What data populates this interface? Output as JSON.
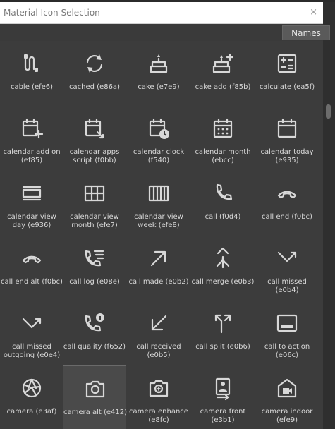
{
  "window": {
    "title": "Material Icon Selection",
    "close": "×"
  },
  "toolbar": {
    "names_label": "Names"
  },
  "icons": [
    [
      "cable (efe6)",
      "cable-icon"
    ],
    [
      "cached (e86a)",
      "cached-icon"
    ],
    [
      "cake (e7e9)",
      "cake-icon"
    ],
    [
      "cake add (f85b)",
      "cake-add-icon"
    ],
    [
      "calculate (ea5f)",
      "calculate-icon"
    ],
    [
      "calendar add on (ef85)",
      "calendar-add-on-icon"
    ],
    [
      "calendar apps script (f0bb)",
      "calendar-apps-script-icon"
    ],
    [
      "calendar clock (f540)",
      "calendar-clock-icon"
    ],
    [
      "calendar month (ebcc)",
      "calendar-month-icon"
    ],
    [
      "calendar today (e935)",
      "calendar-today-icon"
    ],
    [
      "calendar view day (e936)",
      "calendar-view-day-icon"
    ],
    [
      "calendar view month (efe7)",
      "calendar-view-month-icon"
    ],
    [
      "calendar view week (efe8)",
      "calendar-view-week-icon"
    ],
    [
      "call (f0d4)",
      "call-icon"
    ],
    [
      "call end (f0bc)",
      "call-end-icon"
    ],
    [
      "call end alt (f0bc)",
      "call-end-alt-icon"
    ],
    [
      "call log (e08e)",
      "call-log-icon"
    ],
    [
      "call made (e0b2)",
      "call-made-icon"
    ],
    [
      "call merge (e0b3)",
      "call-merge-icon"
    ],
    [
      "call missed (e0b4)",
      "call-missed-icon"
    ],
    [
      "call missed outgoing (e0e4)",
      "call-missed-outgoing-icon"
    ],
    [
      "call quality (f652)",
      "call-quality-icon"
    ],
    [
      "call received (e0b5)",
      "call-received-icon"
    ],
    [
      "call split (e0b6)",
      "call-split-icon"
    ],
    [
      "call to action (e06c)",
      "call-to-action-icon"
    ],
    [
      "camera (e3af)",
      "camera-icon"
    ],
    [
      "camera alt (e412)",
      "camera-alt-icon"
    ],
    [
      "camera enhance (e8fc)",
      "camera-enhance-icon"
    ],
    [
      "camera front (e3b1)",
      "camera-front-icon"
    ],
    [
      "camera indoor (efe9)",
      "camera-indoor-icon"
    ]
  ],
  "selected_index": 26
}
